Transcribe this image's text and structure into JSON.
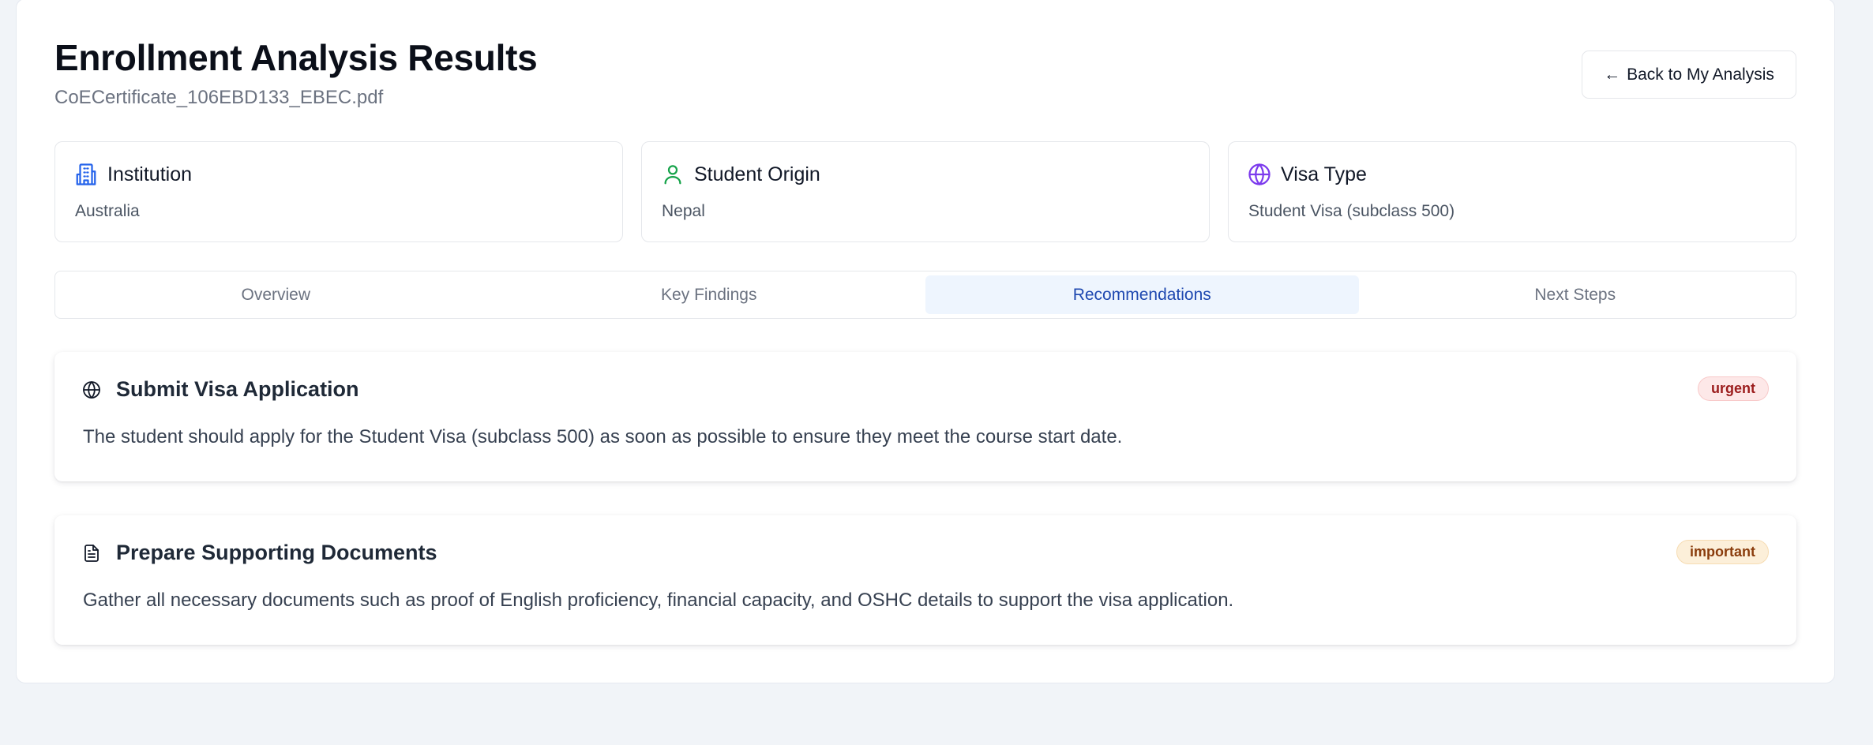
{
  "header": {
    "title": "Enrollment Analysis Results",
    "file_name": "CoECertificate_106EBD133_EBEC.pdf",
    "back_label": "Back to My Analysis",
    "back_icon": "arrow-left-icon"
  },
  "info_cards": [
    {
      "title": "Institution",
      "value": "Australia",
      "icon": "building-icon",
      "icon_color": "#2563eb"
    },
    {
      "title": "Student Origin",
      "value": "Nepal",
      "icon": "user-icon",
      "icon_color": "#16a34a"
    },
    {
      "title": "Visa Type",
      "value": "Student Visa (subclass 500)",
      "icon": "globe-icon",
      "icon_color": "#7c3aed"
    }
  ],
  "tabs": {
    "items": [
      "Overview",
      "Key Findings",
      "Recommendations",
      "Next Steps"
    ],
    "active": "Recommendations"
  },
  "recommendations": [
    {
      "icon": "globe-icon",
      "title": "Submit Visa Application",
      "text": "The student should apply for the Student Visa (subclass 500) as soon as possible to ensure they meet the course start date.",
      "badge": "urgent"
    },
    {
      "icon": "document-icon",
      "title": "Prepare Supporting Documents",
      "text": "Gather all necessary documents such as proof of English proficiency, financial capacity, and OSHC details to support the visa application.",
      "badge": "important"
    }
  ],
  "colors": {
    "page_bg": "#f1f4f8",
    "accent": "#1e48b0",
    "active_tab_bg": "#eef5fe",
    "urgent_bg": "#fde8e8",
    "urgent_text": "#9b1c1c",
    "important_bg": "#fcefd9",
    "important_text": "#8a3c0c"
  }
}
